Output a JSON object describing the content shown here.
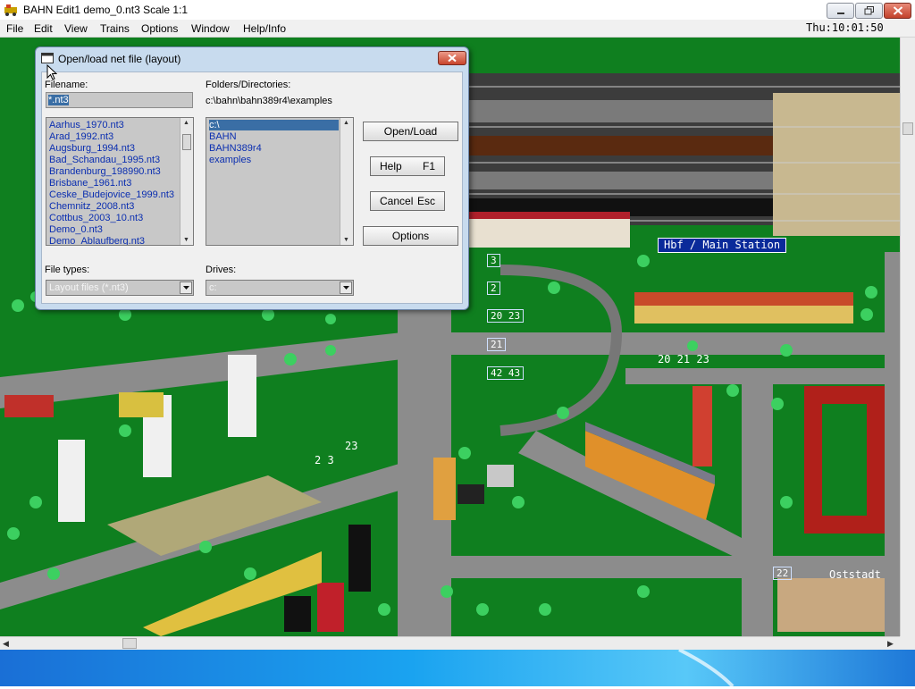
{
  "window": {
    "title": "BAHN Edit1 demo_0.nt3 Scale 1:1",
    "clock": "Thu:10:01:50"
  },
  "menu": {
    "items": [
      "File",
      "Edit",
      "View",
      "Trains",
      "Options",
      "Window",
      "Help/Info"
    ]
  },
  "dialog": {
    "title": "Open/load net file (layout)",
    "filename_label": "Filename:",
    "filename_value": "*.nt3",
    "folders_label": "Folders/Directories:",
    "current_path": "c:\\bahn\\bahn389r4\\examples",
    "files": [
      "Aarhus_1970.nt3",
      "Arad_1992.nt3",
      "Augsburg_1994.nt3",
      "Bad_Schandau_1995.nt3",
      "Brandenburg_198990.nt3",
      "Brisbane_1961.nt3",
      "Ceske_Budejovice_1999.nt3",
      "Chemnitz_2008.nt3",
      "Cottbus_2003_10.nt3",
      "Demo_0.nt3",
      "Demo_Ablaufberg.nt3"
    ],
    "folders": [
      "c:\\",
      "BAHN",
      "BAHN389r4",
      "examples"
    ],
    "buttons": {
      "open": "Open/Load",
      "help": "Help",
      "help_key": "F1",
      "cancel": "Cancel",
      "cancel_key": "Esc",
      "options": "Options"
    },
    "file_types_label": "File types:",
    "file_types_value": "Layout files (*.nt3)",
    "drives_label": "Drives:",
    "drives_value": "c:"
  },
  "map": {
    "station_sign": "Hbf / Main Station",
    "platforms": [
      "3",
      "2",
      "20 23",
      "21",
      "42 43"
    ],
    "labels": {
      "route_20_21_23": "20 21 23",
      "route_23": "23",
      "route_2_3": "2 3",
      "stop_22": "22",
      "ostst": "Oststadt"
    }
  },
  "colors": {
    "grass": "#0f7f1f",
    "road": "#8c8c8c",
    "dialog_frame": "#c8dbee",
    "taskbar": "#1aa3f0",
    "selection": "#3a6ea5",
    "station_sign": "#0a2a9a"
  }
}
